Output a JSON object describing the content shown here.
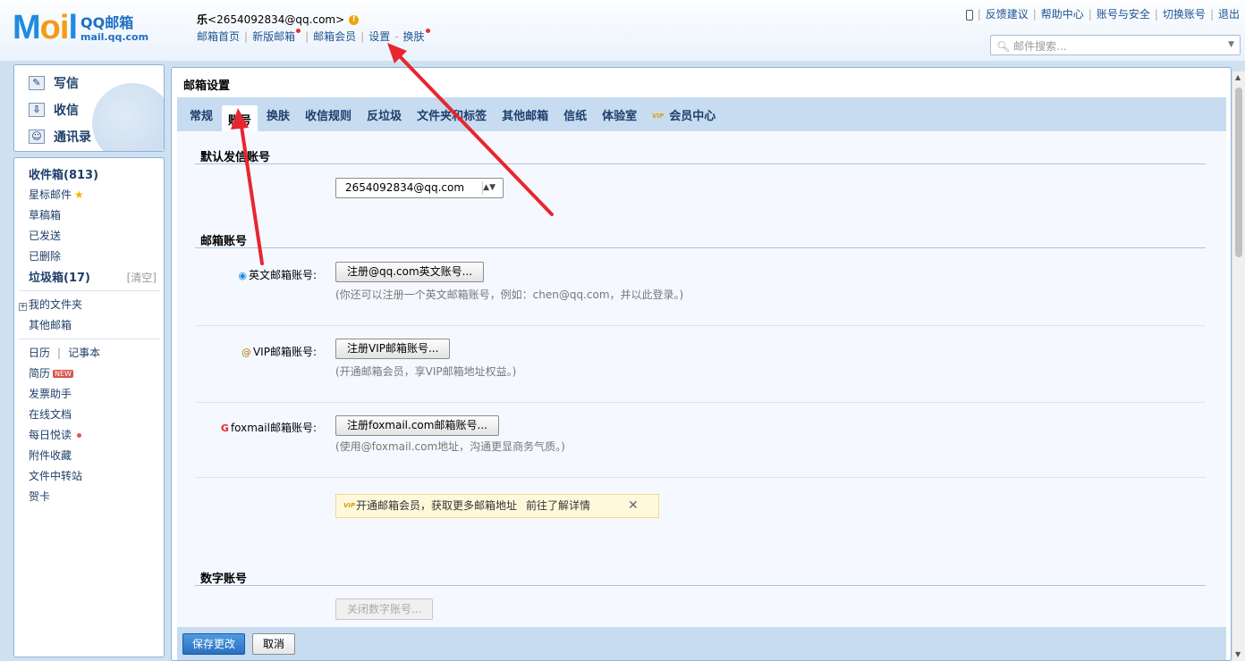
{
  "header": {
    "logo_mail": "M",
    "logo_mail_o": "oi",
    "logo_mail_l": "l",
    "logo_cn": "QQ邮箱",
    "logo_domain": "mail.qq.com",
    "user_name": "乐",
    "user_email": "<2654092834@qq.com>",
    "warn_icon": "!",
    "links": [
      "邮箱首页",
      "新版邮箱",
      "邮箱会员",
      "设置",
      "换肤"
    ],
    "sep": "|",
    "dash": "-",
    "right_links": [
      "反馈建议",
      "帮助中心",
      "账号与安全",
      "切换账号",
      "退出"
    ],
    "search_placeholder": "邮件搜索..."
  },
  "left": {
    "quick": [
      "写信",
      "收信",
      "通讯录"
    ],
    "inbox": "收件箱(813)",
    "starred": "星标邮件",
    "drafts": "草稿箱",
    "sent": "已发送",
    "deleted": "已删除",
    "spam": "垃圾箱(17)",
    "spam_clean": "[清空]",
    "my_folders": "我的文件夹",
    "other_mail": "其他邮箱",
    "calendar": "日历",
    "notebook": "记事本",
    "resume": "简历",
    "new_badge": "NEW",
    "invoice": "发票助手",
    "online_docs": "在线文档",
    "daily_read": "每日悦读",
    "attachments": "附件收藏",
    "transfer": "文件中转站",
    "cards": "贺卡"
  },
  "main": {
    "title": "邮箱设置",
    "tabs": [
      "常规",
      "账号",
      "换肤",
      "收信规则",
      "反垃圾",
      "文件夹和标签",
      "其他邮箱",
      "信纸",
      "体验室",
      "会员中心"
    ],
    "active_tab": "账号",
    "vip_tag": "VIP",
    "sections": {
      "default_sender": "默认发信账号",
      "default_sender_value": "2654092834@qq.com",
      "mail_accounts": "邮箱账号",
      "digital_accounts": "数字账号"
    },
    "rows": [
      {
        "label": "英文邮箱账号:",
        "button": "注册@qq.com英文账号...",
        "note": "(你还可以注册一个英文邮箱账号，例如：chen@qq.com，并以此登录。)"
      },
      {
        "label": "VIP邮箱账号:",
        "button": "注册VIP邮箱账号...",
        "note": "(开通邮箱会员，享VIP邮箱地址权益。)"
      },
      {
        "label": "foxmail邮箱账号:",
        "button": "注册foxmail.com邮箱账号...",
        "note": "(使用@foxmail.com地址，沟通更显商务气质。)"
      }
    ],
    "tip_text": "开通邮箱会员，获取更多邮箱地址",
    "tip_link": "前往了解详情",
    "tip_close": "✕",
    "digital_button": "关闭数字账号...",
    "save": "保存更改",
    "cancel": "取消"
  },
  "colors": {
    "accent": "#1f8be0",
    "annotation_arrow": "#e8262f",
    "tab_bar": "#c7dcf1"
  }
}
